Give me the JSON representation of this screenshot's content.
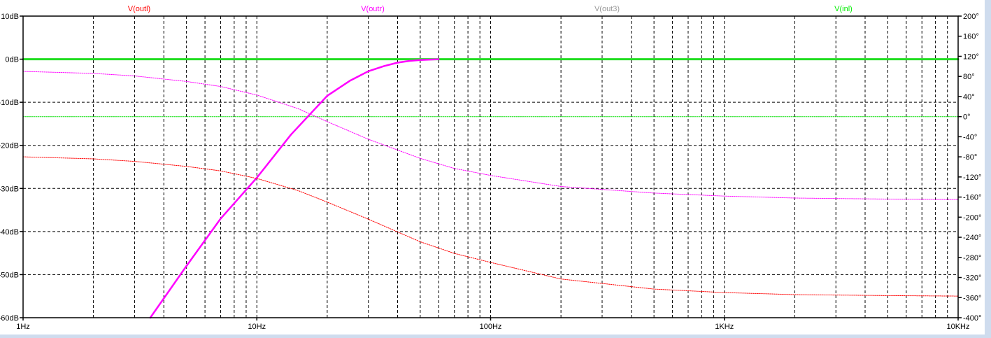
{
  "chart_data": {
    "type": "line",
    "xscale": "log",
    "xlim": [
      1,
      10000
    ],
    "ylim_left": [
      -60,
      10
    ],
    "ylim_right": [
      -400,
      200
    ],
    "grid": true,
    "legend_placement": "top",
    "x_ticks": [
      {
        "value": 1,
        "label": "1Hz"
      },
      {
        "value": 10,
        "label": "10Hz"
      },
      {
        "value": 100,
        "label": "100Hz"
      },
      {
        "value": 1000,
        "label": "1KHz"
      },
      {
        "value": 10000,
        "label": "10KHz"
      }
    ],
    "y_ticks_left": [
      {
        "value": 10,
        "label": "10dB"
      },
      {
        "value": 0,
        "label": "0dB"
      },
      {
        "value": -10,
        "label": "-10dB"
      },
      {
        "value": -20,
        "label": "-20dB"
      },
      {
        "value": -30,
        "label": "-30dB"
      },
      {
        "value": -40,
        "label": "-40dB"
      },
      {
        "value": -50,
        "label": "-50dB"
      },
      {
        "value": -60,
        "label": "-60dB"
      }
    ],
    "y_ticks_right": [
      {
        "value": 200,
        "label": "200°"
      },
      {
        "value": 160,
        "label": "160°"
      },
      {
        "value": 120,
        "label": "120°"
      },
      {
        "value": 80,
        "label": "80°"
      },
      {
        "value": 40,
        "label": "40°"
      },
      {
        "value": 0,
        "label": "0°"
      },
      {
        "value": -40,
        "label": "-40°"
      },
      {
        "value": -80,
        "label": "-80°"
      },
      {
        "value": -120,
        "label": "-120°"
      },
      {
        "value": -160,
        "label": "-160°"
      },
      {
        "value": -200,
        "label": "-200°"
      },
      {
        "value": -240,
        "label": "-240°"
      },
      {
        "value": -280,
        "label": "-280°"
      },
      {
        "value": -320,
        "label": "-320°"
      },
      {
        "value": -360,
        "label": "-360°"
      },
      {
        "value": -400,
        "label": "-400°"
      }
    ],
    "legend": [
      {
        "label": "V(outl)",
        "color": "#ff0000"
      },
      {
        "label": "V(outr)",
        "color": "#ff00ff"
      },
      {
        "label": "V(out3)",
        "color": "#999999"
      },
      {
        "label": "V(inl)",
        "color": "#00ee00"
      }
    ],
    "series": [
      {
        "name": "V(inl)",
        "color": "#22dd22",
        "style": "solid",
        "width": 3,
        "axis": "left",
        "x": [
          1,
          10000
        ],
        "y": [
          0,
          0
        ]
      },
      {
        "name": "V(inl)",
        "color": "#00dd00",
        "style": "dotted",
        "width": 1,
        "axis": "right",
        "x": [
          1,
          10000
        ],
        "y": [
          0,
          0
        ]
      },
      {
        "name": "V(outr)",
        "color": "#ff00ff",
        "style": "solid",
        "width": 2.5,
        "axis": "left",
        "x": [
          3.5,
          5,
          7,
          10,
          14,
          20,
          25,
          30,
          35,
          40,
          45,
          50,
          60
        ],
        "y": [
          -60,
          -48,
          -37,
          -27.5,
          -17.5,
          -8.5,
          -5,
          -2.8,
          -1.6,
          -0.8,
          -0.4,
          -0.2,
          0
        ]
      },
      {
        "name": "V(outr)",
        "color": "#ff00ff",
        "style": "dotted",
        "width": 1,
        "axis": "right",
        "x": [
          1,
          2,
          3,
          5,
          7,
          10,
          15,
          20,
          30,
          50,
          70,
          100,
          200,
          500,
          1000,
          2000,
          5000,
          10000
        ],
        "y": [
          90,
          86,
          81,
          70,
          60,
          43,
          16,
          -10,
          -45,
          -83,
          -103,
          -117,
          -139,
          -152,
          -158,
          -162,
          -164,
          -165
        ]
      },
      {
        "name": "V(outl)",
        "color": "#ff0000",
        "style": "dotted",
        "width": 1,
        "axis": "right",
        "x": [
          1,
          2,
          3,
          5,
          7,
          10,
          15,
          20,
          30,
          50,
          70,
          100,
          200,
          500,
          1000,
          2000,
          5000,
          10000
        ],
        "y": [
          -80,
          -84,
          -89,
          -99,
          -108,
          -123,
          -147,
          -170,
          -204,
          -249,
          -272,
          -290,
          -323,
          -343,
          -350,
          -354,
          -356,
          -357
        ]
      }
    ]
  }
}
